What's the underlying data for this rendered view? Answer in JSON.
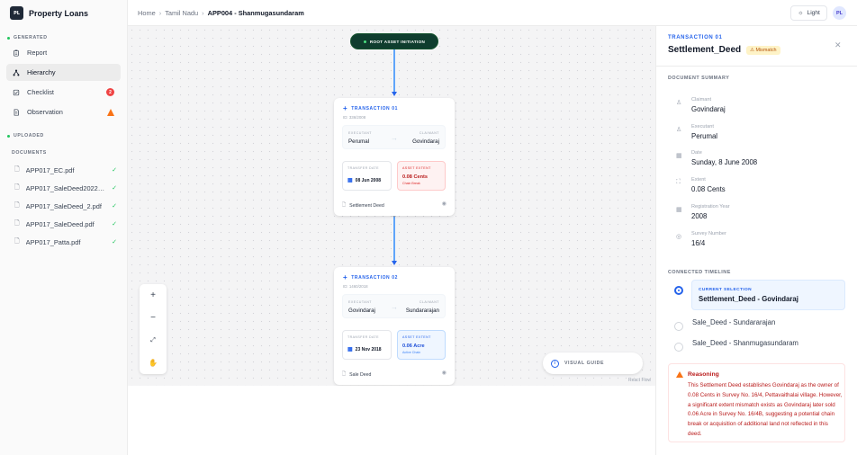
{
  "app": {
    "logo_text": "PL",
    "title": "Property Loans"
  },
  "sidebar": {
    "generated_label": "GENERATED",
    "generated_items": [
      {
        "label": "Report",
        "icon": "clipboard-icon"
      },
      {
        "label": "Hierarchy",
        "icon": "hierarchy-icon",
        "active": true
      },
      {
        "label": "Checklist",
        "icon": "checklist-icon",
        "badge": "2"
      },
      {
        "label": "Observation",
        "icon": "document-icon",
        "warning": true
      }
    ],
    "uploaded_label": "UPLOADED",
    "documents_label": "DOCUMENTS",
    "documents": [
      "APP017_EC.pdf",
      "APP017_SaleDeed2022_...",
      "APP017_SaleDeed_2.pdf",
      "APP017_SaleDeed.pdf",
      "APP017_Patta.pdf"
    ]
  },
  "breadcrumb": {
    "home": "Home",
    "state": "Tamil Nadu",
    "current": "APP004 - Shanmugasundaram"
  },
  "topbar": {
    "theme_label": "Light",
    "avatar": "PL"
  },
  "canvas": {
    "root_label": "ROOT ASSET INITIATION",
    "cards": [
      {
        "title": "TRANSACTION 01",
        "id": "ID: 336/2008",
        "executant_label": "EXECUTANT",
        "executant": "Perumal",
        "claimant_label": "CLAIMANT",
        "claimant": "Govindaraj",
        "transfer_label": "TRANSFER DATE",
        "transfer_date": "08 Jun 2008",
        "extent_label": "ASSET EXTENT",
        "extent": "0.08 Cents",
        "extent_sub": "Chain Break",
        "doc": "Settlement Deed"
      },
      {
        "title": "TRANSACTION 02",
        "id": "ID: 1460/2018",
        "executant_label": "EXECUTANT",
        "executant": "Govindaraj",
        "claimant_label": "CLAIMANT",
        "claimant": "Sundararajan",
        "transfer_label": "TRANSFER DATE",
        "transfer_date": "23 Nov 2018",
        "extent_label": "ASSET EXTENT",
        "extent": "0.06 Acre",
        "extent_sub": "Active Chain",
        "doc": "Sale Deed"
      }
    ],
    "visual_guide": "VISUAL GUIDE",
    "attribution": "React Flow",
    "colors": {
      "chain_break": "#dc2626",
      "active_chain": "#2563eb",
      "root": "#0f3d2e"
    }
  },
  "panel": {
    "overline": "TRANSACTION 01",
    "title": "Settlement_Deed",
    "status": "Mismatch",
    "summary_label": "DOCUMENT SUMMARY",
    "fields": [
      {
        "label": "Claimant",
        "value": "Govindaraj",
        "icon": "user-icon"
      },
      {
        "label": "Executant",
        "value": "Perumal",
        "icon": "user-icon"
      },
      {
        "label": "Date",
        "value": "Sunday, 8 June 2008",
        "icon": "calendar-icon"
      },
      {
        "label": "Extent",
        "value": "0.08 Cents",
        "icon": "expand-icon"
      },
      {
        "label": "Registration Year",
        "value": "2008",
        "icon": "calendar-icon"
      },
      {
        "label": "Survey Number",
        "value": "16/4",
        "icon": "location-icon"
      }
    ],
    "timeline_label": "CONNECTED TIMELINE",
    "current_label": "CURRENT SELECTION",
    "current_value": "Settlement_Deed - Govindaraj",
    "timeline": [
      "Sale_Deed - Sundararajan",
      "Sale_Deed - Shanmugasundaram"
    ],
    "reasoning_title": "Reasoning",
    "reasoning_text": "This Settlement Deed establishes Govindaraj as the owner of 0.08 Cents in Survey No. 16/4, Pettavaithalai village. However, a significant extent mismatch exists as Govindaraj later sold 0.06 Acre in Survey No. 16/4B, suggesting a potential chain break or acquisition of additional land not reflected in this deed."
  }
}
